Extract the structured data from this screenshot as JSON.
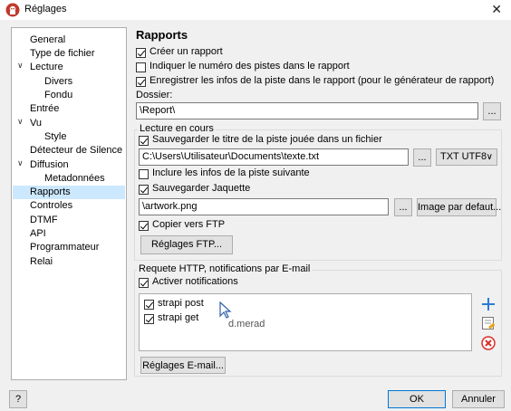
{
  "window": {
    "title": "Réglages"
  },
  "icons": {
    "app": "app-logo-icon",
    "close": "close-icon"
  },
  "tree": {
    "items": [
      {
        "label": "General"
      },
      {
        "label": "Type de fichier"
      },
      {
        "label": "Lecture"
      },
      {
        "label": "Divers"
      },
      {
        "label": "Fondu"
      },
      {
        "label": "Entrée"
      },
      {
        "label": "Vu"
      },
      {
        "label": "Style"
      },
      {
        "label": "Détecteur de Silence"
      },
      {
        "label": "Diffusion"
      },
      {
        "label": "Metadonnées"
      },
      {
        "label": "Rapports"
      },
      {
        "label": "Controles"
      },
      {
        "label": "DTMF"
      },
      {
        "label": "API"
      },
      {
        "label": "Programmateur"
      },
      {
        "label": "Relai"
      }
    ],
    "selected": "Rapports"
  },
  "main": {
    "title": "Rapports",
    "create_report": {
      "label": "Créer un rapport",
      "checked": true
    },
    "track_numbers": {
      "label": "Indiquer le numéro des pistes dans le rapport",
      "checked": false
    },
    "save_track_info": {
      "label": "Enregistrer les infos de la piste dans le rapport (pour le générateur de rapport)",
      "checked": true
    },
    "folder": {
      "label": "Dossier:",
      "value": "\\Report\\",
      "browse_label": "..."
    },
    "now_playing": {
      "legend": "Lecture en cours",
      "save_title": {
        "label": "Sauvegarder le titre de la piste jouée dans un fichier",
        "checked": true
      },
      "file_path": "C:\\Users\\Utilisateur\\Documents\\texte.txt",
      "browse_label": "...",
      "encoding": "TXT UTF8",
      "include_next": {
        "label": "Inclure les infos de la piste suivante",
        "checked": false
      },
      "save_artwork": {
        "label": "Sauvegarder Jaquette",
        "checked": true
      },
      "artwork_path": "\\artwork.png",
      "artwork_browse_label": "...",
      "default_image_label": "Image par defaut...",
      "copy_ftp": {
        "label": "Copier vers FTP",
        "checked": true
      },
      "ftp_settings_label": "Réglages FTP..."
    },
    "http": {
      "legend": "Requete HTTP, notifications par E-mail",
      "enable_notifications": {
        "label": "Activer notifications",
        "checked": true
      },
      "items": [
        {
          "label": "strapi post",
          "checked": true
        },
        {
          "label": "strapi get",
          "checked": true
        }
      ],
      "hover_text": "d.merad",
      "email_settings_label": "Réglages E-mail...",
      "side_icons": [
        "add-icon",
        "edit-icon",
        "delete-icon"
      ]
    }
  },
  "footer": {
    "help_label": "?",
    "ok_label": "OK",
    "cancel_label": "Annuler"
  },
  "colors": {
    "selection": "#cce8ff",
    "primary_border": "#0078d7",
    "add": "#2b7cd3",
    "delete": "#d9302c"
  }
}
